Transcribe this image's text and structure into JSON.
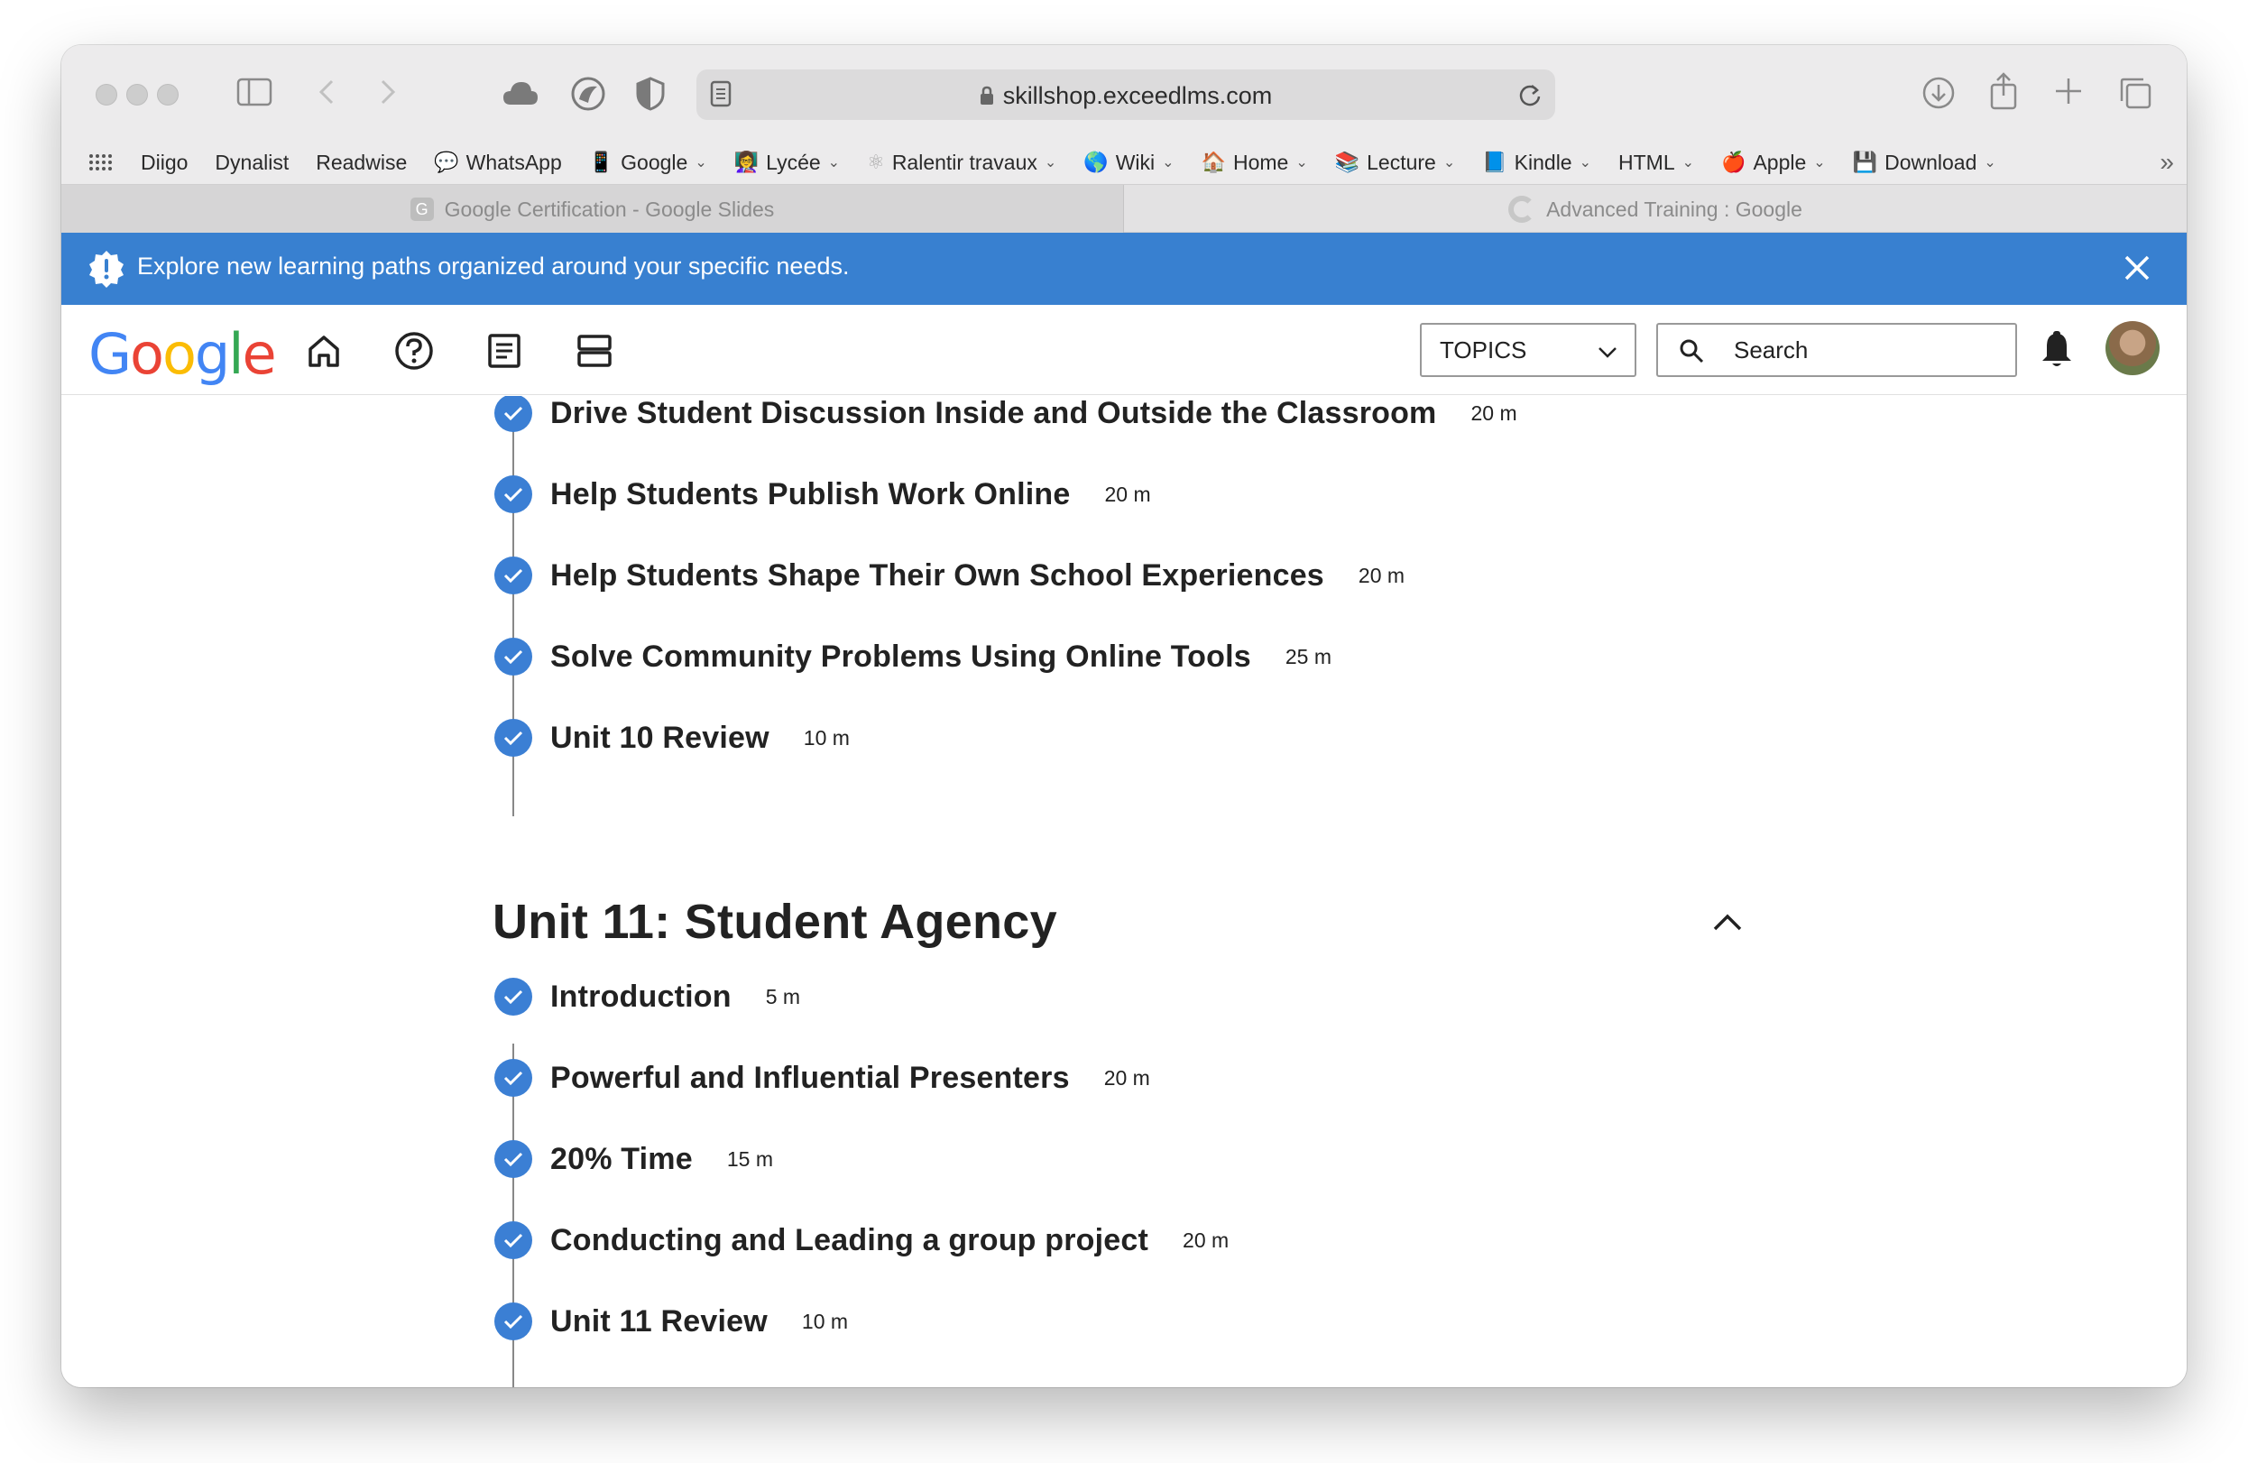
{
  "browser": {
    "url": "skillshop.exceedlms.com",
    "bookmarks": [
      {
        "label": "Diigo",
        "emoji": "",
        "dropdown": false
      },
      {
        "label": "Dynalist",
        "emoji": "",
        "dropdown": false
      },
      {
        "label": "Readwise",
        "emoji": "",
        "dropdown": false
      },
      {
        "label": "WhatsApp",
        "emoji": "💬",
        "dropdown": false
      },
      {
        "label": "Google",
        "emoji": "📱",
        "dropdown": true
      },
      {
        "label": "Lycée",
        "emoji": "👩‍🏫",
        "dropdown": true
      },
      {
        "label": "Ralentir travaux",
        "emoji": "⚛",
        "dropdown": true
      },
      {
        "label": "Wiki",
        "emoji": "🌎",
        "dropdown": true
      },
      {
        "label": "Home",
        "emoji": "🏠",
        "dropdown": true
      },
      {
        "label": "Lecture",
        "emoji": "📚",
        "dropdown": true
      },
      {
        "label": "Kindle",
        "emoji": "📘",
        "dropdown": true
      },
      {
        "label": "HTML",
        "emoji": "",
        "dropdown": true
      },
      {
        "label": "Apple",
        "emoji": "🍎",
        "dropdown": true
      },
      {
        "label": "Download",
        "emoji": "💾",
        "dropdown": true
      }
    ],
    "tabs": [
      {
        "label": "Google Certification - Google Slides",
        "favicon_letter": "G"
      },
      {
        "label": "Advanced Training : Google"
      }
    ]
  },
  "banner": {
    "text": "Explore new learning paths organized around your specific needs.",
    "color": "#3880d0"
  },
  "header": {
    "logo": "Google",
    "topics_label": "TOPICS",
    "search_placeholder": "Search"
  },
  "unit10": {
    "lessons": [
      {
        "title": "Drive Student Discussion Inside and Outside the Classroom",
        "duration": "20 m"
      },
      {
        "title": "Help Students Publish Work Online",
        "duration": "20 m"
      },
      {
        "title": "Help Students Shape Their Own School Experiences",
        "duration": "20 m"
      },
      {
        "title": "Solve Community Problems Using Online Tools",
        "duration": "25 m"
      },
      {
        "title": "Unit 10 Review",
        "duration": "10 m"
      }
    ]
  },
  "unit11": {
    "title": "Unit 11: Student Agency",
    "lessons": [
      {
        "title": "Introduction",
        "duration": "5 m"
      },
      {
        "title": "Powerful and Influential Presenters",
        "duration": "20 m"
      },
      {
        "title": "20% Time",
        "duration": "15 m"
      },
      {
        "title": "Conducting and Leading a group project",
        "duration": "20 m"
      },
      {
        "title": "Unit 11 Review",
        "duration": "10 m"
      }
    ]
  },
  "colors": {
    "accent": "#3b7fd4",
    "google_blue": "#4285F4",
    "google_red": "#EA4335",
    "google_yellow": "#FBBC05",
    "google_green": "#34A853"
  }
}
